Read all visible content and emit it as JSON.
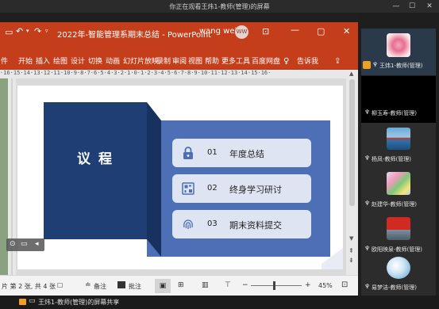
{
  "meeting": {
    "banner": "你正在观看王炜1-教师(管理)的屏幕",
    "share_label": "王炜1-教师(管理)的屏幕共享"
  },
  "ppt": {
    "title": "2022年-智能管理系期末总结  -  PowerPoint",
    "user_name": "wang wei",
    "user_initials": "WW",
    "tabs": [
      "件",
      "开始",
      "插入",
      "绘图",
      "设计",
      "切换",
      "动画",
      "幻灯片放映",
      "录制",
      "审阅",
      "视图",
      "帮助",
      "更多工具",
      "百度网盘",
      "告诉我"
    ],
    "ruler_text": "·16·15·14·13·12·11·10·9·8·7·6·5·4·3·2·1·0·1·2·3·4·5·6·7·8·9·10·11·12·13·14·15·16·",
    "status": {
      "slide_info": "片 第 2 张, 共 4 张",
      "notes": "备注",
      "comments": "批注",
      "zoom": "45%"
    }
  },
  "slide": {
    "heading": "议  程",
    "items": [
      {
        "num": "01",
        "label": "年度总结",
        "icon": "lock-icon"
      },
      {
        "num": "02",
        "label": "终身学习研讨",
        "icon": "qr-icon"
      },
      {
        "num": "03",
        "label": "期末资料提交",
        "icon": "fingerprint-icon"
      }
    ],
    "colors": {
      "dark_blue": "#1f3f74",
      "mid_blue": "#4c6fb5",
      "card": "#dfe4f2",
      "ppt_red": "#c43e1c"
    }
  },
  "participants": [
    {
      "name": "王炜1-教师(管理)",
      "avatar": "flower"
    },
    {
      "name": "柳玉寿-教师(管理)",
      "avatar": "black"
    },
    {
      "name": "杨凤-教师(管理)",
      "avatar": "ocean"
    },
    {
      "name": "赵建华-教师(管理)",
      "avatar": "flowers"
    },
    {
      "name": "欧阳映泉-教师(管理)",
      "avatar": "flag"
    },
    {
      "name": "易梦洁-教师(管理)",
      "avatar": "bubble"
    }
  ]
}
